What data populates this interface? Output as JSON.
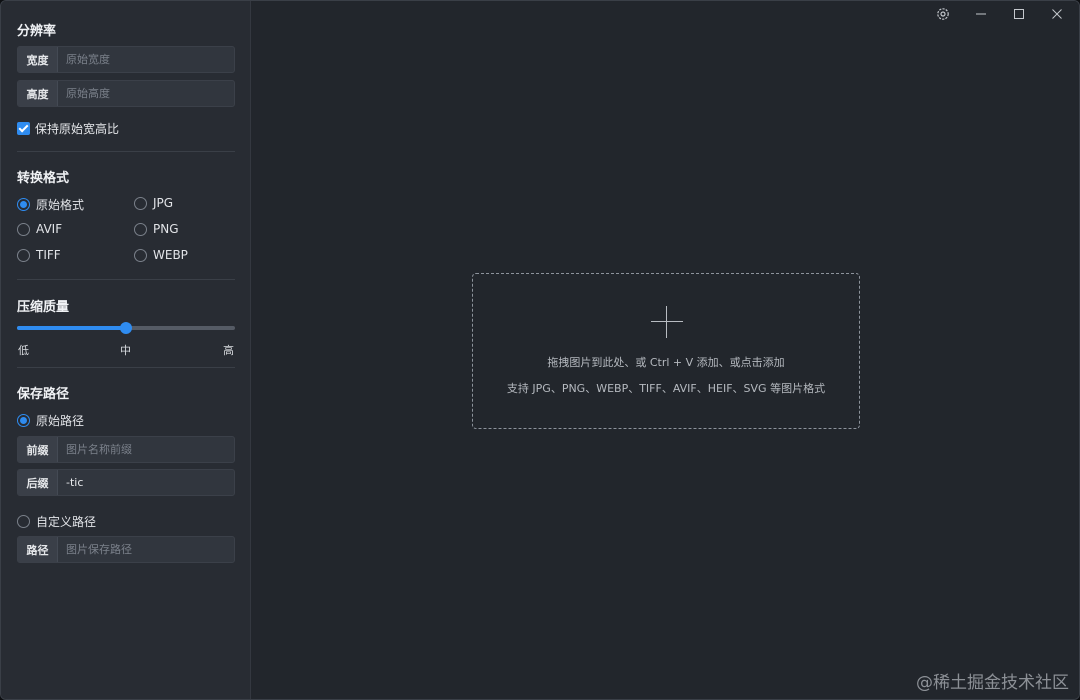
{
  "resolution": {
    "title": "分辨率",
    "width": {
      "label": "宽度",
      "placeholder": "原始宽度"
    },
    "height": {
      "label": "高度",
      "placeholder": "原始高度"
    },
    "keep_ratio_label": "保持原始宽高比",
    "keep_ratio_checked": true
  },
  "format": {
    "title": "转换格式",
    "options": [
      "原始格式",
      "JPG",
      "AVIF",
      "PNG",
      "TIFF",
      "WEBP"
    ],
    "selected": "原始格式"
  },
  "quality": {
    "title": "压缩质量",
    "low": "低",
    "mid": "中",
    "high": "高",
    "value_fraction": 0.5
  },
  "save_path": {
    "title": "保存路径",
    "original_label": "原始路径",
    "prefix": {
      "label": "前缀",
      "placeholder": "图片名称前缀",
      "value": ""
    },
    "suffix": {
      "label": "后缀",
      "placeholder": "",
      "value": "-tic"
    },
    "custom_label": "自定义路径",
    "path": {
      "label": "路径",
      "placeholder": "图片保存路径"
    }
  },
  "dropzone": {
    "line1": "拖拽图片到此处、或 Ctrl + V 添加、或点击添加",
    "line2": "支持 JPG、PNG、WEBP、TIFF、AVIF、HEIF、SVG 等图片格式"
  },
  "window_controls": [
    "settings-icon",
    "minimize-icon",
    "maximize-icon",
    "close-icon"
  ],
  "watermark": "@稀土掘金技术社区",
  "colors": {
    "accent": "#2f8cf0",
    "sidebar_bg": "#282c33",
    "main_bg": "#22262c"
  }
}
